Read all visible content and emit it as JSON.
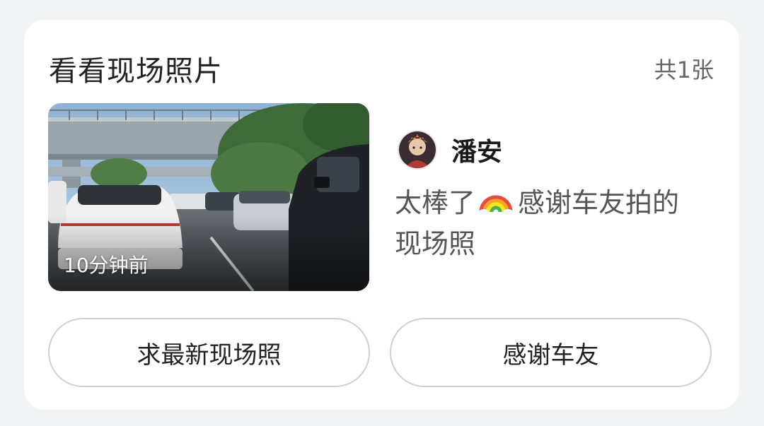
{
  "card": {
    "title": "看看现场照片",
    "count": "共1张"
  },
  "photo": {
    "time_ago": "10分钟前"
  },
  "post": {
    "author": "潘安",
    "comment_prefix": "太棒了",
    "emoji": "rainbow",
    "comment_suffix": "感谢车友拍的现场照"
  },
  "actions": {
    "request_label": "求最新现场照",
    "thanks_label": "感谢车友"
  },
  "colors": {
    "card_bg": "#ffffff",
    "page_bg": "#f2f3f5",
    "button_border": "#cfcfcf"
  }
}
